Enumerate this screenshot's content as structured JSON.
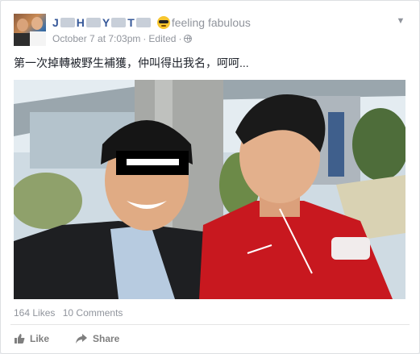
{
  "post": {
    "author": {
      "name_parts": [
        "J",
        "H",
        "Y",
        "T"
      ],
      "feeling": "feeling fabulous"
    },
    "timestamp": "October 7 at 7:03pm",
    "edited": "Edited",
    "text": "第一次掉轉被野生補獲，仲叫得出我名，呵呵...",
    "stats": {
      "likes": "164 Likes",
      "comments": "10 Comments"
    },
    "actions": {
      "like": "Like",
      "share": "Share"
    }
  },
  "colors": {
    "link": "#365899",
    "meta": "#90949c",
    "action": "#7f7f7f"
  },
  "icons": [
    "chevron-down-icon",
    "globe-icon",
    "sunglasses-emoji-icon",
    "like-icon",
    "share-icon"
  ]
}
